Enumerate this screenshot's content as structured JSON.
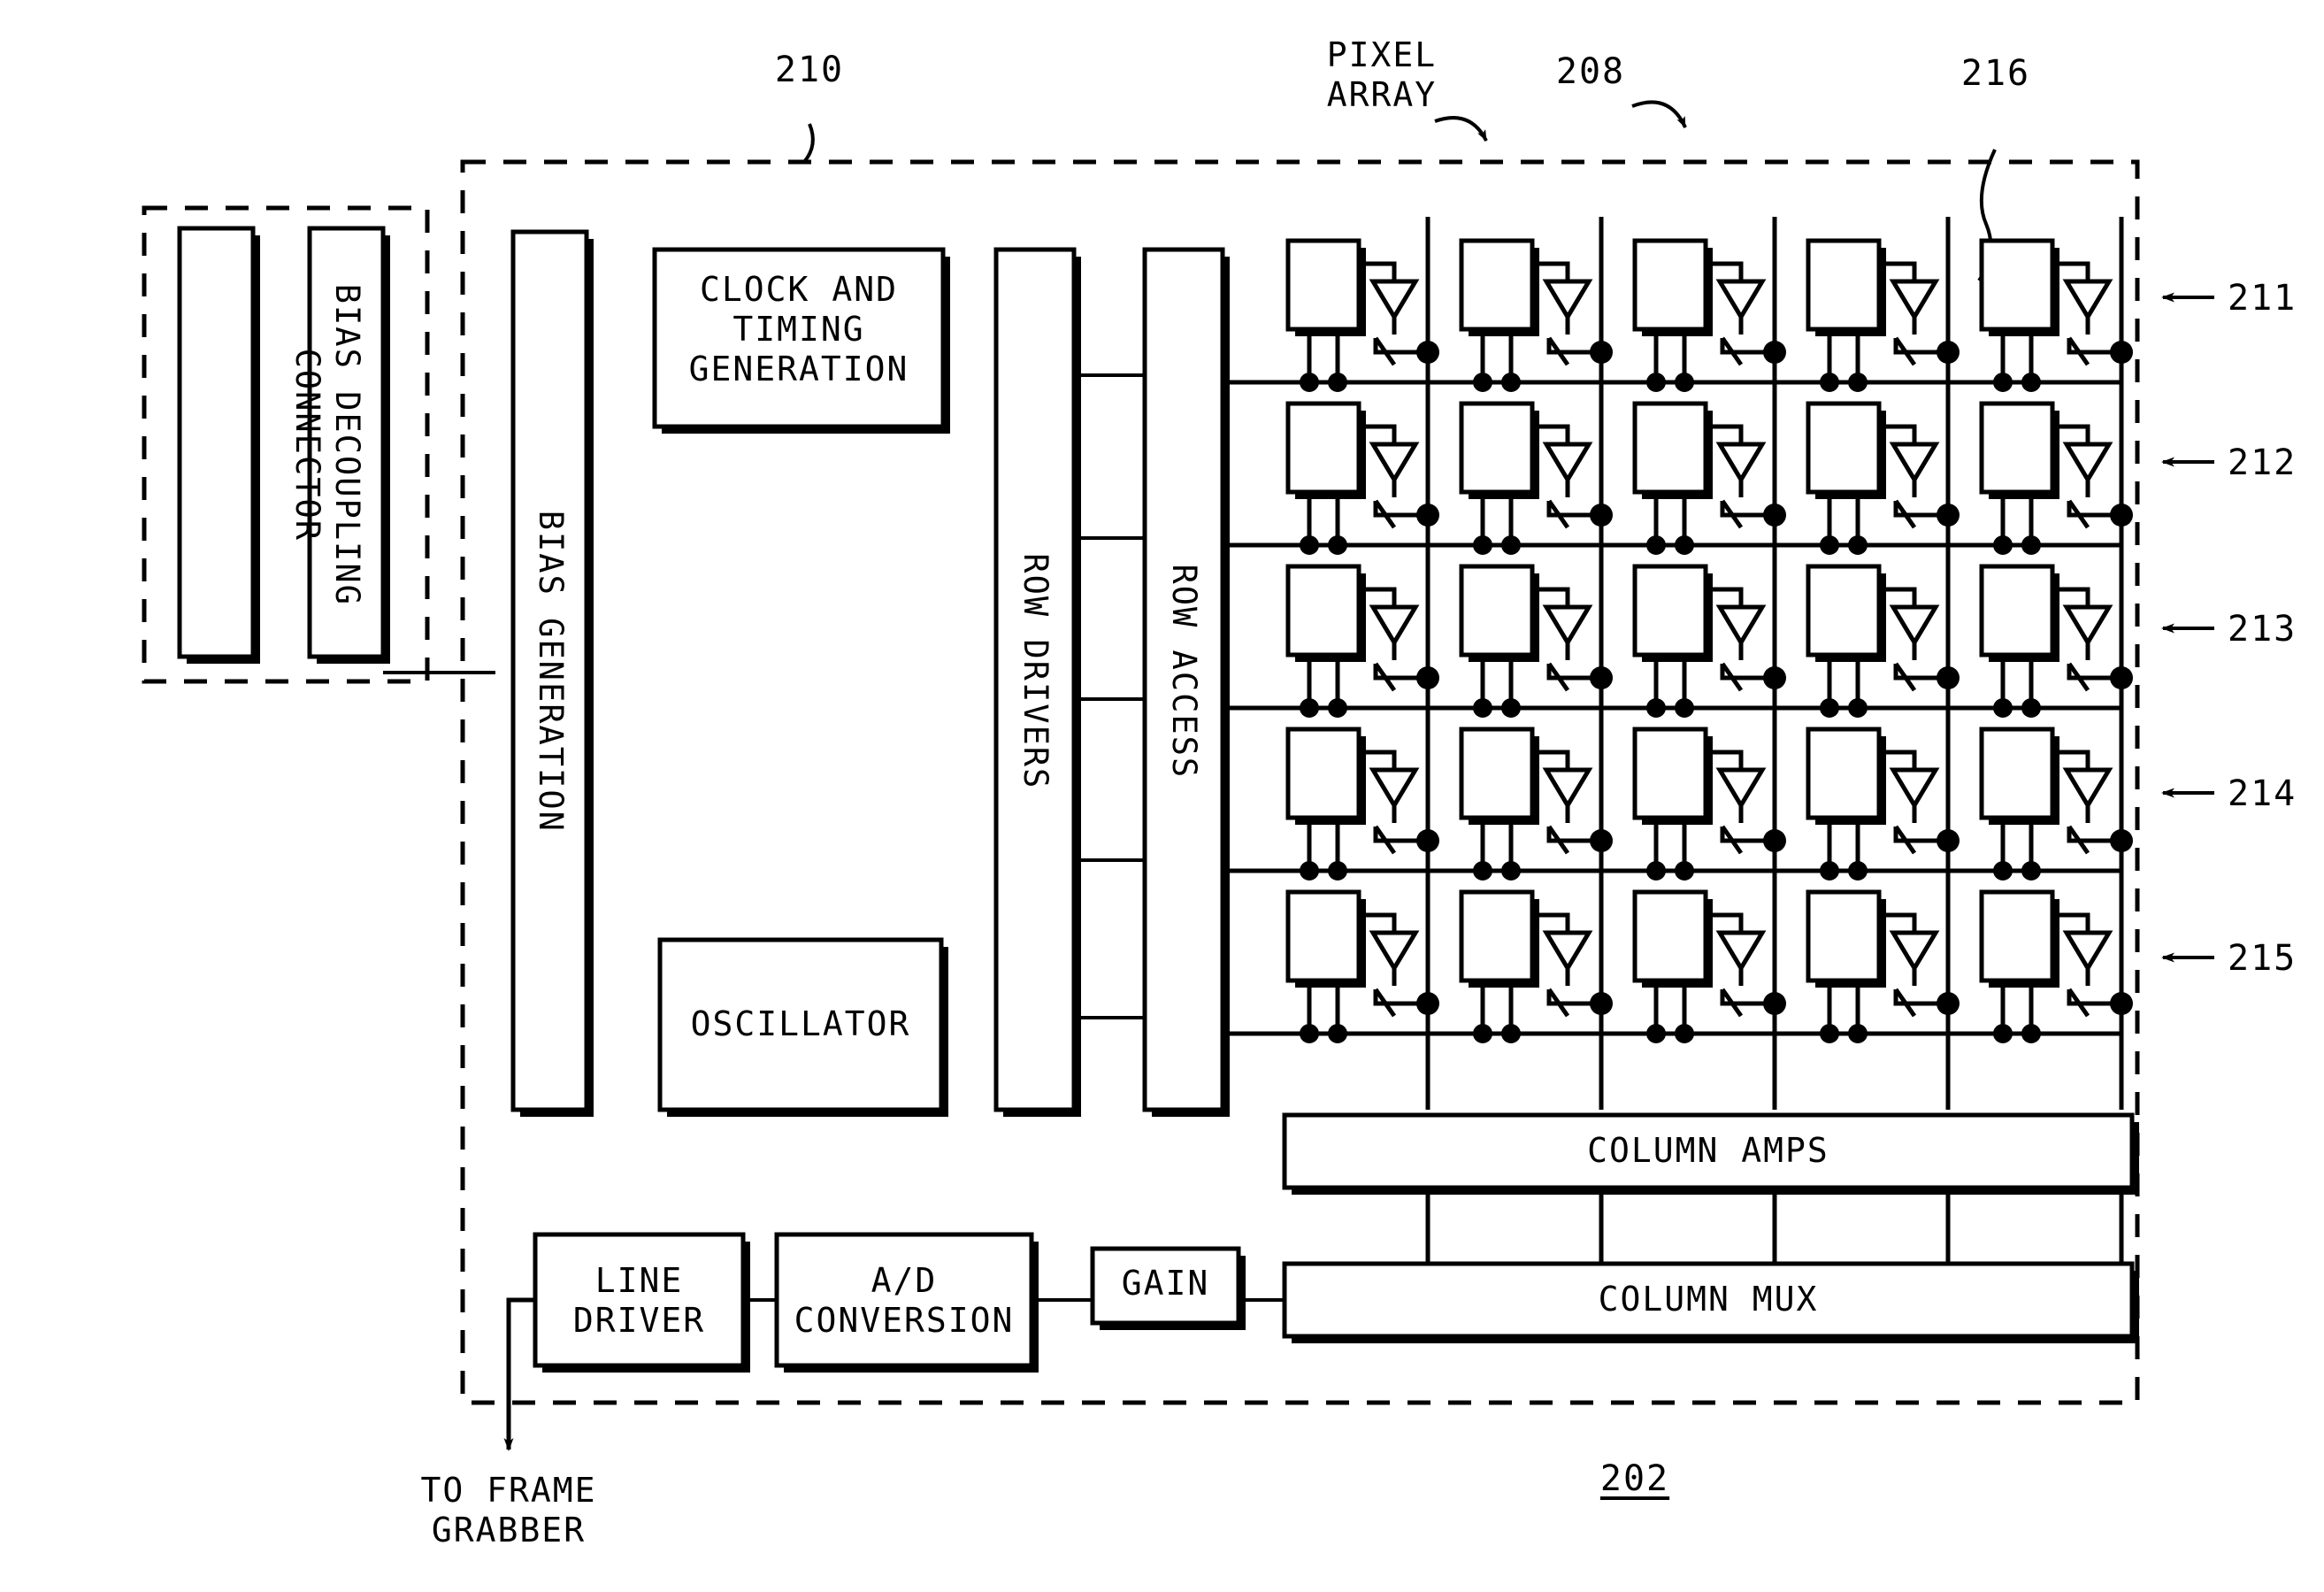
{
  "figure": {
    "caption": "202",
    "caption_underlined": true,
    "outer_ref": "210",
    "pixel_array_label": "PIXEL\nARRAY",
    "pixel_array_ref": "208",
    "pixel_cell_ref": "216",
    "output_label": "TO FRAME\nGRABBER"
  },
  "left_module": {
    "blocks": [
      {
        "id": "connector",
        "label": "CONNECTOR",
        "orientation": "vertical"
      },
      {
        "id": "bias-decoupling",
        "label": "BIAS DECOUPLING",
        "orientation": "vertical"
      }
    ]
  },
  "main_module": {
    "blocks": [
      {
        "id": "bias-generation",
        "label": "BIAS GENERATION",
        "orientation": "vertical"
      },
      {
        "id": "clock-and-timing-generation",
        "label": "CLOCK AND\nTIMING\nGENERATION",
        "orientation": "horizontal"
      },
      {
        "id": "oscillator",
        "label": "OSCILLATOR",
        "orientation": "horizontal"
      },
      {
        "id": "row-drivers",
        "label": "ROW DRIVERS",
        "orientation": "vertical"
      },
      {
        "id": "row-access",
        "label": "ROW ACCESS",
        "orientation": "vertical"
      },
      {
        "id": "column-amps",
        "label": "COLUMN AMPS",
        "orientation": "horizontal"
      },
      {
        "id": "column-mux",
        "label": "COLUMN MUX",
        "orientation": "horizontal"
      },
      {
        "id": "gain",
        "label": "GAIN",
        "orientation": "horizontal"
      },
      {
        "id": "ad-conversion",
        "label": "A/D\nCONVERSION",
        "orientation": "horizontal"
      },
      {
        "id": "line-driver",
        "label": "LINE\nDRIVER",
        "orientation": "horizontal"
      }
    ]
  },
  "pixel_array": {
    "rows": 5,
    "columns": 5,
    "row_refs": [
      "211",
      "212",
      "213",
      "214",
      "215"
    ]
  },
  "colors": {
    "ink": "#000000",
    "paper": "#ffffff"
  }
}
